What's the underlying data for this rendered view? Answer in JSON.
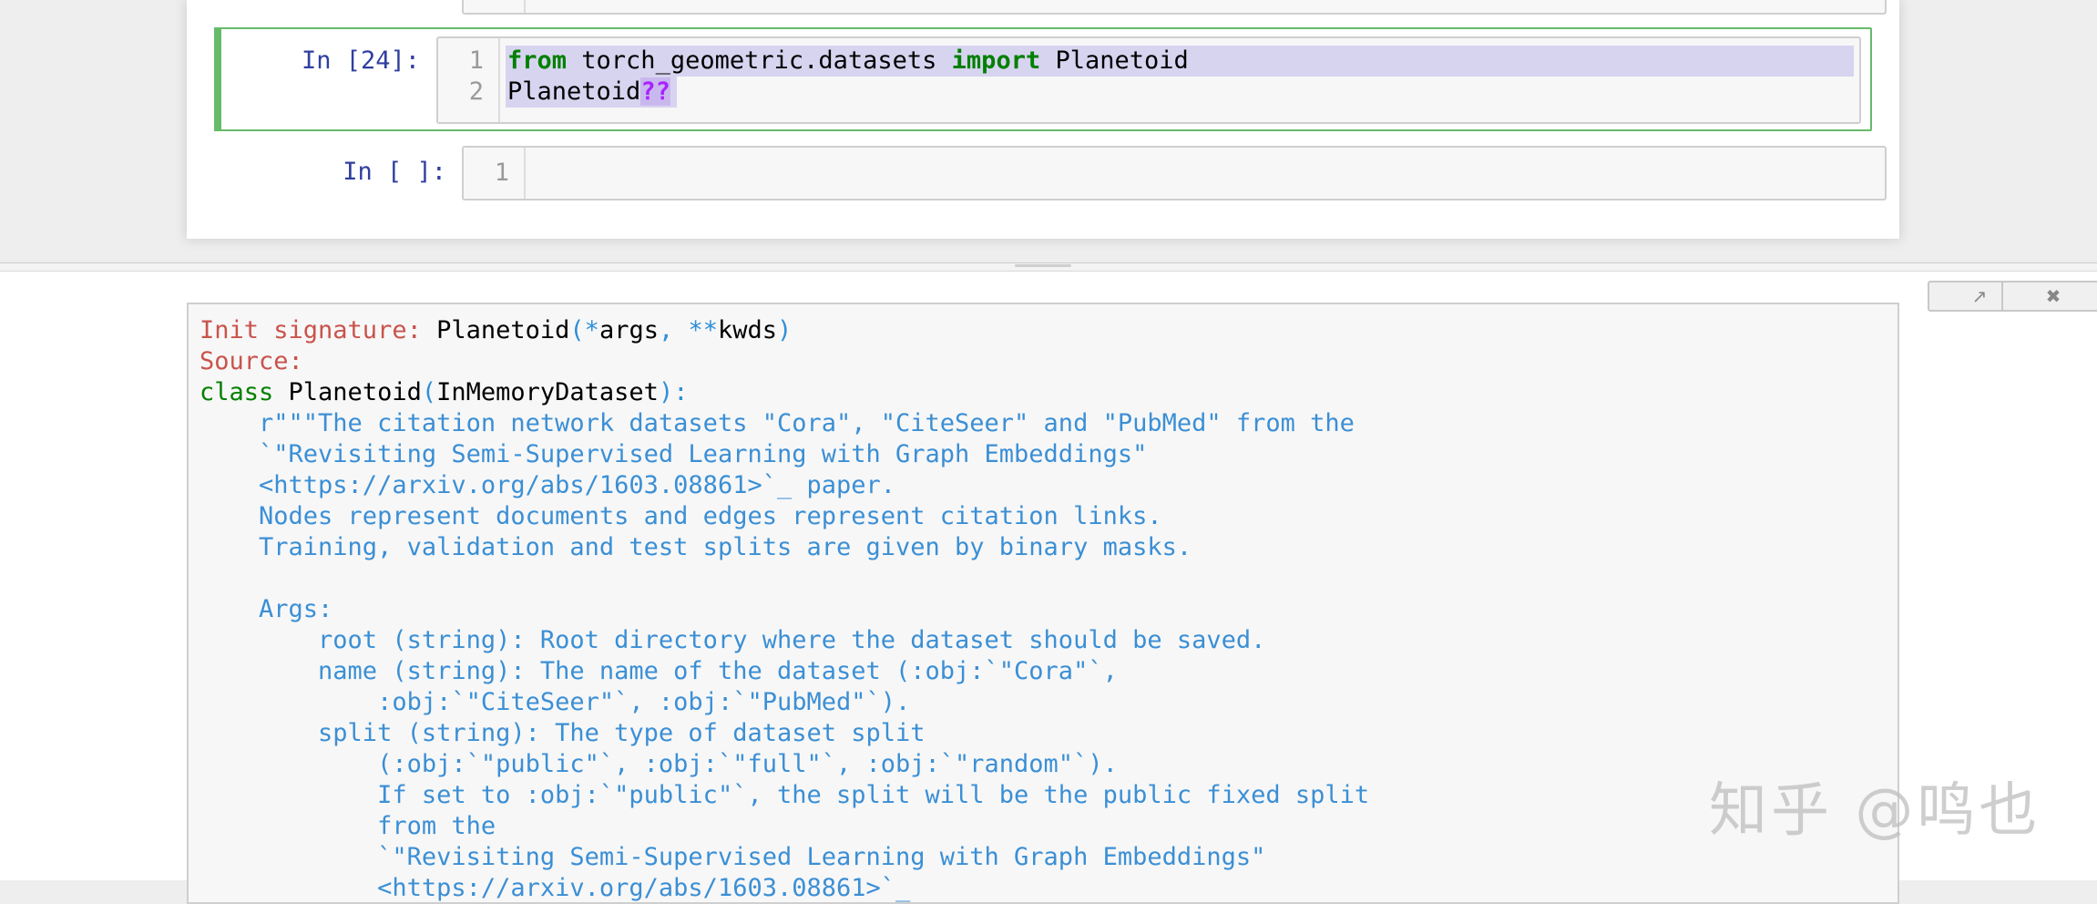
{
  "cells": {
    "cell_24": {
      "prompt": "In [24]:",
      "line_numbers": [
        "1",
        "2"
      ],
      "line1": {
        "kw1": "from",
        "mod": " torch_geometric.datasets ",
        "kw2": "import",
        "name": " Planetoid"
      },
      "line2": {
        "name": "Planetoid",
        "op": "??"
      }
    },
    "cell_empty": {
      "prompt": "In [ ]:",
      "line_numbers": [
        "1"
      ]
    }
  },
  "pager": {
    "open_button_icon": "external-open-icon",
    "close_button_icon": "close-icon",
    "init_signature_label": "Init signature:",
    "init_signature_name": " Planetoid",
    "sig_open": "(",
    "sig_star": "*",
    "sig_args": "args",
    "sig_comma": ", ",
    "sig_dstar": "**",
    "sig_kwds": "kwds",
    "sig_close": ")",
    "source_label": "Source:",
    "class_kw": "class",
    "class_name": " Planetoid",
    "class_paren_open": "(",
    "class_base": "InMemoryDataset",
    "class_paren_close": "):",
    "doc_lines": [
      "    r\"\"\"The citation network datasets \"Cora\", \"CiteSeer\" and \"PubMed\" from the",
      "    `\"Revisiting Semi-Supervised Learning with Graph Embeddings\"",
      "    <https://arxiv.org/abs/1603.08861>`_ paper.",
      "    Nodes represent documents and edges represent citation links.",
      "    Training, validation and test splits are given by binary masks.",
      "",
      "    Args:",
      "        root (string): Root directory where the dataset should be saved.",
      "        name (string): The name of the dataset (:obj:`\"Cora\"`,",
      "            :obj:`\"CiteSeer\"`, :obj:`\"PubMed\"`).",
      "        split (string): The type of dataset split",
      "            (:obj:`\"public\"`, :obj:`\"full\"`, :obj:`\"random\"`).",
      "            If set to :obj:`\"public\"`, the split will be the public fixed split",
      "            from the",
      "            `\"Revisiting Semi-Supervised Learning with Graph Embeddings\"",
      "            <https://arxiv.org/abs/1603.08861>`_"
    ]
  },
  "watermark": "知乎 @鸣也",
  "colors": {
    "prompt": "#303f9f",
    "keyword": "#008000",
    "operator": "#aa22ff",
    "docstring": "#3b8fd5",
    "label_red": "#c9534c",
    "selected_border": "#66bb6a"
  }
}
